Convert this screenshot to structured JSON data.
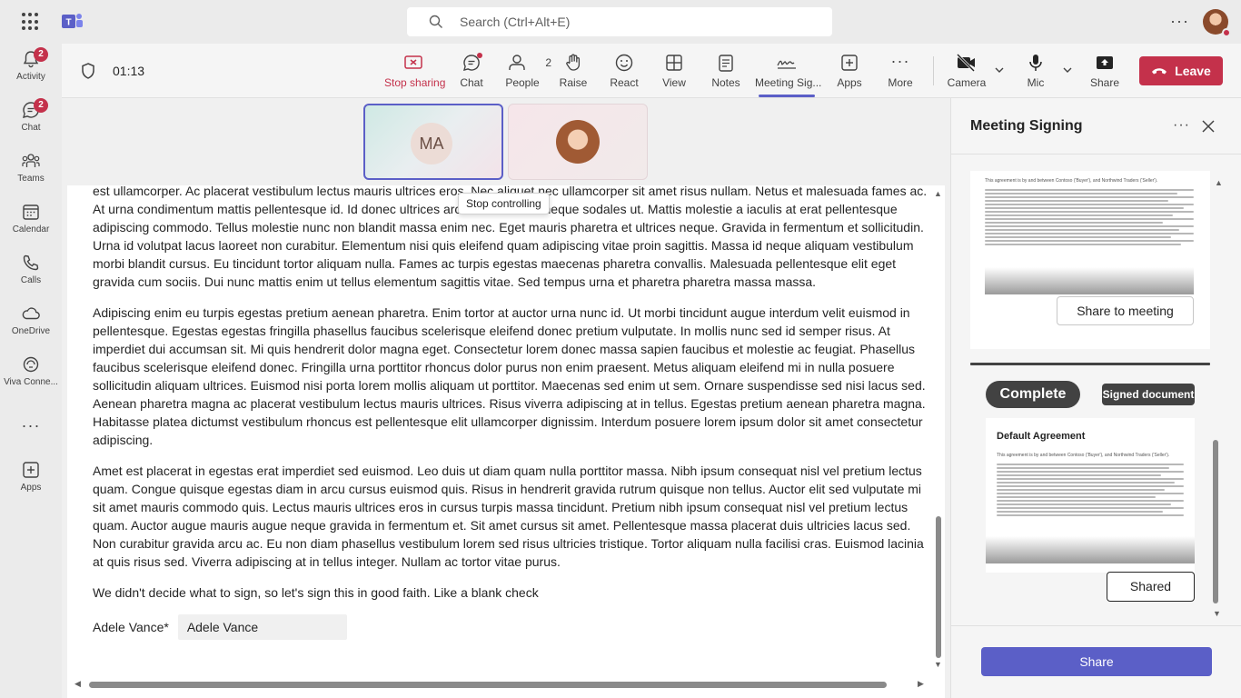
{
  "app": {
    "search_placeholder": "Search (Ctrl+Alt+E)"
  },
  "rail": [
    {
      "label": "Activity",
      "badge": "2"
    },
    {
      "label": "Chat",
      "badge": "2"
    },
    {
      "label": "Teams"
    },
    {
      "label": "Calendar"
    },
    {
      "label": "Calls"
    },
    {
      "label": "OneDrive"
    },
    {
      "label": "Viva Conne..."
    },
    {
      "label": "Apps"
    }
  ],
  "meeting": {
    "timer": "01:13",
    "toolbar": {
      "stop_sharing": "Stop sharing",
      "chat": "Chat",
      "people": "People",
      "people_count": "2",
      "raise": "Raise",
      "react": "React",
      "view": "View",
      "notes": "Notes",
      "meeting_signing": "Meeting Sig...",
      "apps": "Apps",
      "more": "More",
      "camera": "Camera",
      "mic": "Mic",
      "share": "Share",
      "leave": "Leave"
    },
    "participants": [
      {
        "initials": "MA"
      },
      {
        "initials": ""
      }
    ],
    "tooltip": "Stop controlling"
  },
  "document": {
    "paragraphs": [
      "est ullamcorper. Ac placerat vestibulum lectus mauris ultrices eros. Nec aliquet nec ullamcorper sit amet risus nullam. Netus et malesuada fames ac. At urna condimentum mattis pellentesque id. Id donec ultrices arcu non sodales neque sodales ut. Mattis molestie a iaculis at erat pellentesque adipiscing commodo. Tellus molestie nunc non blandit massa enim nec. Eget mauris pharetra et ultrices neque. Gravida in fermentum et sollicitudin. Urna id volutpat lacus laoreet non curabitur. Elementum nisi quis eleifend quam adipiscing vitae proin sagittis. Massa id neque aliquam vestibulum morbi blandit cursus. Eu tincidunt tortor aliquam nulla. Fames ac turpis egestas maecenas pharetra convallis. Malesuada pellentesque elit eget gravida cum sociis. Dui nunc mattis enim ut tellus elementum sagittis vitae. Sed tempus urna et pharetra pharetra massa massa.",
      "Adipiscing enim eu turpis egestas pretium aenean pharetra. Enim tortor at auctor urna nunc id. Ut morbi tincidunt augue interdum velit euismod in pellentesque. Egestas egestas fringilla phasellus faucibus scelerisque eleifend donec pretium vulputate. In mollis nunc sed id semper risus. At imperdiet dui accumsan sit. Mi quis hendrerit dolor magna eget. Consectetur lorem donec massa sapien faucibus et molestie ac feugiat. Phasellus faucibus scelerisque eleifend donec. Fringilla urna porttitor rhoncus dolor purus non enim praesent. Metus aliquam eleifend mi in nulla posuere sollicitudin aliquam ultrices. Euismod nisi porta lorem mollis aliquam ut porttitor. Maecenas sed enim ut sem. Ornare suspendisse sed nisi lacus sed. Aenean pharetra magna ac placerat vestibulum lectus mauris ultrices. Risus viverra adipiscing at in tellus. Egestas pretium aenean pharetra magna. Habitasse platea dictumst vestibulum rhoncus est pellentesque elit ullamcorper dignissim. Interdum posuere lorem ipsum dolor sit amet consectetur adipiscing.",
      "Amet est placerat in egestas erat imperdiet sed euismod. Leo duis ut diam quam nulla porttitor massa. Nibh ipsum consequat nisl vel pretium lectus quam. Congue quisque egestas diam in arcu cursus euismod quis. Risus in hendrerit gravida rutrum quisque non tellus. Auctor elit sed vulputate mi sit amet mauris commodo quis. Lectus mauris ultrices eros in cursus turpis massa tincidunt. Pretium nibh ipsum consequat nisl vel pretium lectus quam. Auctor augue mauris augue neque gravida in fermentum et. Sit amet cursus sit amet. Pellentesque massa placerat duis ultricies lacus sed. Non curabitur gravida arcu ac. Eu non diam phasellus vestibulum lorem sed risus ultricies tristique. Tortor aliquam nulla facilisi cras. Euismod lacinia at quis risus sed. Viverra adipiscing at in tellus integer. Nullam ac tortor vitae purus.",
      "We didn't decide what to sign, so let's sign this in good faith. Like a blank check"
    ],
    "signer_label": "Adele Vance*",
    "signer_value": "Adele Vance"
  },
  "panel": {
    "title": "Meeting Signing",
    "card1": {
      "preview_heading": "This agreement is by and between Contoso ('Buyer'), and Northwind Traders ('Seller').",
      "share_button": "Share to meeting"
    },
    "status": "Complete",
    "signed_label": "Signed document",
    "card2": {
      "title": "Default Agreement",
      "preview_heading": "This agreement is by and between Contoso ('Buyer'), and Northwind Traders ('Seller').",
      "shared_button": "Shared"
    },
    "share_button": "Share"
  },
  "colors": {
    "accent": "#5b5fc7",
    "leave": "#c4314b",
    "badge": "#c4314b"
  }
}
